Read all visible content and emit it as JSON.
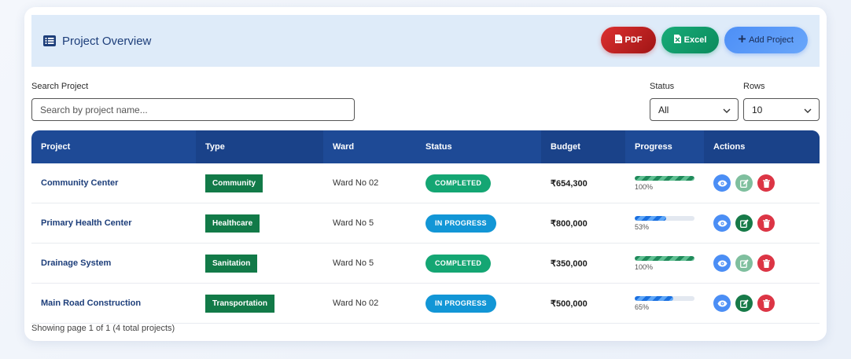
{
  "header": {
    "title": "Project Overview",
    "title_icon": "list-icon",
    "buttons": {
      "pdf": "PDF",
      "excel": "Excel",
      "add": "Add Project"
    }
  },
  "filters": {
    "search_label": "Search Project",
    "search_placeholder": "Search by project name...",
    "status_label": "Status",
    "status_value": "All",
    "rows_label": "Rows",
    "rows_value": "10"
  },
  "table": {
    "columns": [
      "Project",
      "Type",
      "Ward",
      "Status",
      "Budget",
      "Progress",
      "Actions"
    ],
    "rows": [
      {
        "project": "Community Center",
        "type": "Community",
        "ward": "Ward No 02",
        "status": "COMPLETED",
        "status_kind": "completed",
        "budget": "₹654,300",
        "progress": 100,
        "progress_label": "100%",
        "edit_muted": true
      },
      {
        "project": "Primary Health Center",
        "type": "Healthcare",
        "ward": "Ward No 5",
        "status": "IN PROGRESS",
        "status_kind": "in-progress",
        "budget": "₹800,000",
        "progress": 53,
        "progress_label": "53%",
        "edit_muted": false
      },
      {
        "project": "Drainage System",
        "type": "Sanitation",
        "ward": "Ward No 5",
        "status": "COMPLETED",
        "status_kind": "completed",
        "budget": "₹350,000",
        "progress": 100,
        "progress_label": "100%",
        "edit_muted": true
      },
      {
        "project": "Main Road Construction",
        "type": "Transportation",
        "ward": "Ward No 02",
        "status": "IN PROGRESS",
        "status_kind": "in-progress",
        "budget": "₹500,000",
        "progress": 65,
        "progress_label": "65%",
        "edit_muted": false
      }
    ]
  },
  "footer": {
    "text": "Showing page 1 of 1 (4 total projects)"
  },
  "colors": {
    "accent": "#1e4a96",
    "completed": "#14a673",
    "in_progress": "#1296d6",
    "type_badge": "#127a48",
    "view": "#4b8ef5",
    "edit": "#177a48",
    "edit_muted": "#7fbf9e",
    "delete": "#dc3545"
  }
}
